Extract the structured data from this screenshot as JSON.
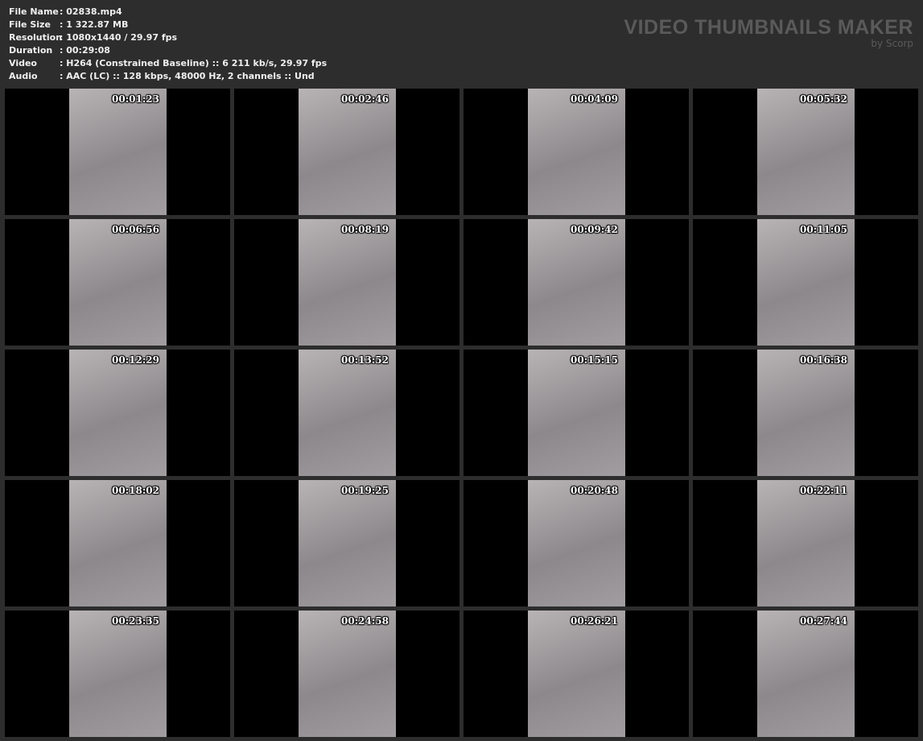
{
  "info": [
    {
      "label": "File Name",
      "value": "02838.mp4"
    },
    {
      "label": "File Size",
      "value": "1 322.87 MB"
    },
    {
      "label": "Resolution",
      "value": "1080x1440 / 29.97 fps"
    },
    {
      "label": "Duration",
      "value": "00:29:08"
    },
    {
      "label": "Video",
      "value": "H264 (Constrained Baseline) :: 6 211 kb/s, 29.97 fps"
    },
    {
      "label": "Audio",
      "value": "AAC (LC) :: 128 kbps, 48000 Hz, 2 channels :: Und"
    }
  ],
  "brand": {
    "title": "VIDEO THUMBNAILS MAKER",
    "subtitle": "by Scorp"
  },
  "timestamps": [
    "00:01:23",
    "00:02:46",
    "00:04:09",
    "00:05:32",
    "00:06:56",
    "00:08:19",
    "00:09:42",
    "00:11:05",
    "00:12:29",
    "00:13:52",
    "00:15:15",
    "00:16:38",
    "00:18:02",
    "00:19:25",
    "00:20:48",
    "00:22:11",
    "00:23:35",
    "00:24:58",
    "00:26:21",
    "00:27:44"
  ]
}
